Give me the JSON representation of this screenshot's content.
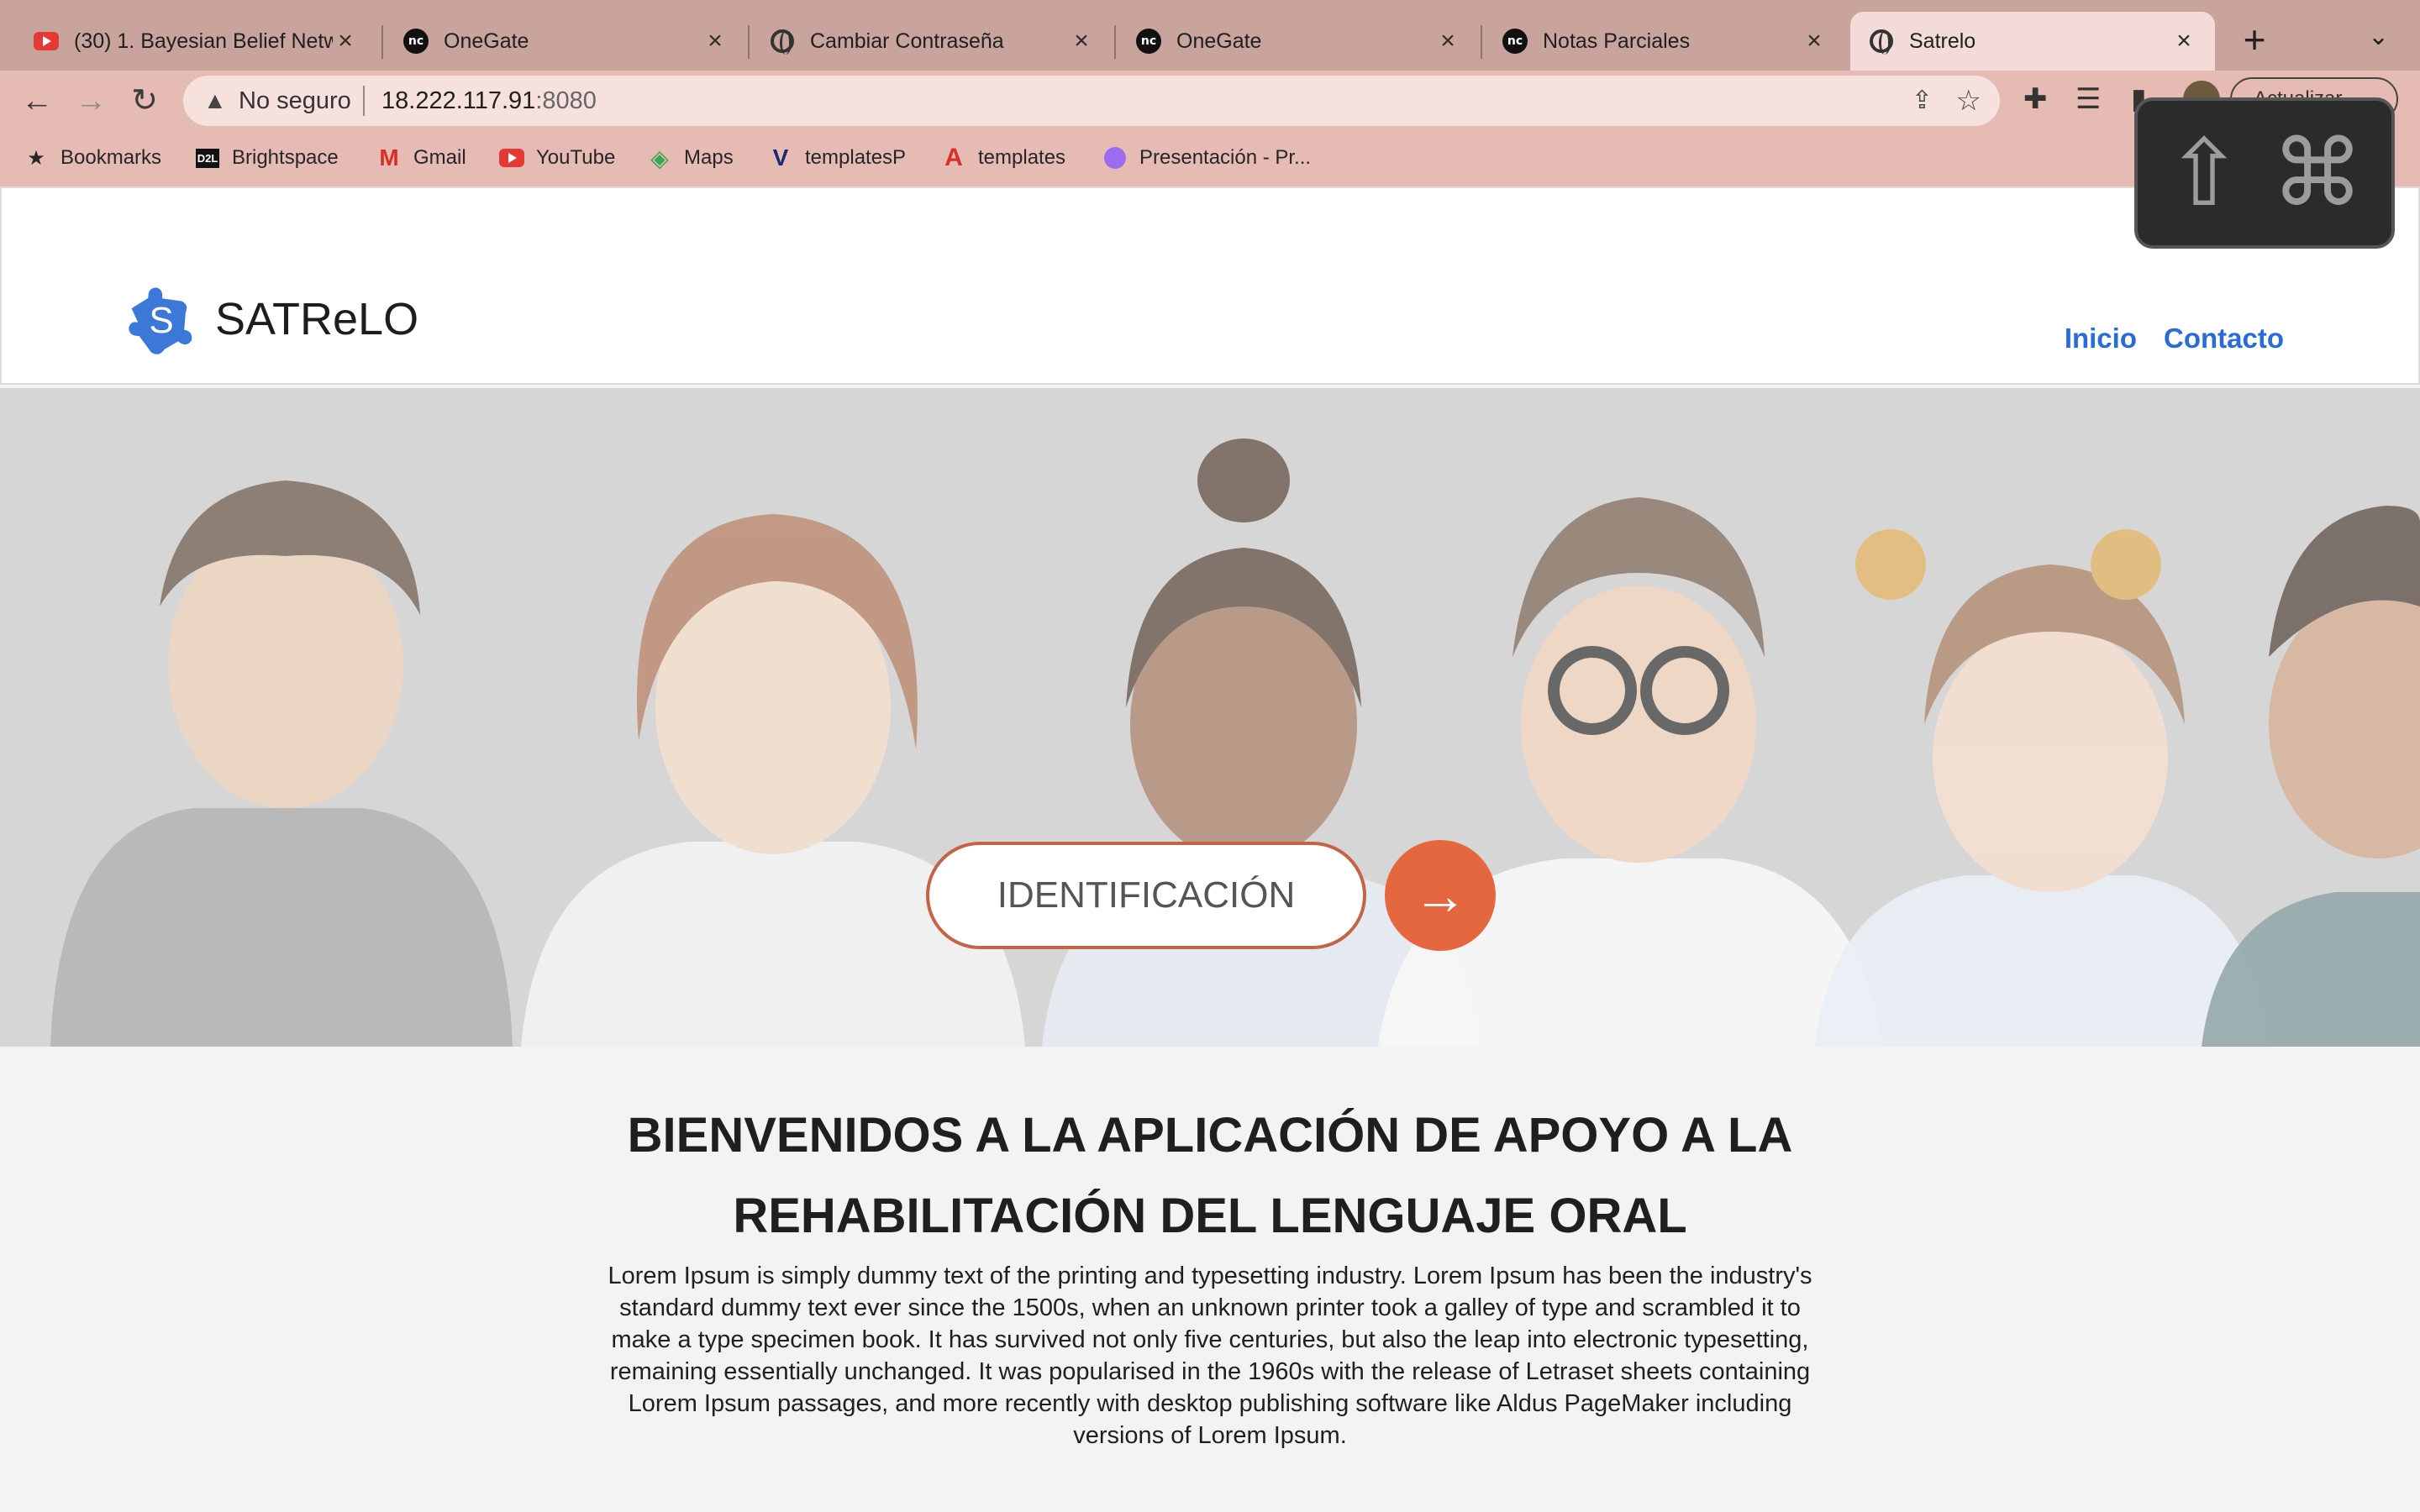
{
  "browser": {
    "tabs": [
      {
        "title": "(30) 1. Bayesian Belief Netw",
        "icon": "youtube-icon"
      },
      {
        "title": "OneGate",
        "icon": "onegate-icon"
      },
      {
        "title": "Cambiar Contraseña",
        "icon": "globe-icon"
      },
      {
        "title": "OneGate",
        "icon": "onegate-icon"
      },
      {
        "title": "Notas Parciales",
        "icon": "onegate-icon"
      },
      {
        "title": "Satrelo",
        "icon": "globe-icon",
        "active": true
      }
    ],
    "address": {
      "security_label": "No seguro",
      "host": "18.222.117.91",
      "port": ":8080"
    },
    "update_button": "Actualizar",
    "bookmarks": [
      {
        "label": "Bookmarks",
        "icon": "star-icon"
      },
      {
        "label": "Brightspace",
        "icon": "d2l-icon"
      },
      {
        "label": "Gmail",
        "icon": "gmail-icon"
      },
      {
        "label": "YouTube",
        "icon": "youtube-icon"
      },
      {
        "label": "Maps",
        "icon": "maps-icon"
      },
      {
        "label": "templatesP",
        "icon": "templatesp-icon"
      },
      {
        "label": "templates",
        "icon": "templates-icon"
      },
      {
        "label": "Presentación - Pr...",
        "icon": "presentation-icon"
      }
    ],
    "shortcut_overlay": {
      "keys": [
        "⇧",
        "⌘"
      ]
    }
  },
  "site": {
    "brand": "SATReLO",
    "nav": {
      "home": "Inicio",
      "contact": "Contacto"
    },
    "hero": {
      "id_button": "IDENTIFICACIÓN",
      "go_button_icon": "arrow-right-icon"
    },
    "welcome_title": "BIENVENIDOS A LA APLICACIÓN DE APOYO A LA REHABILITACIÓN DEL LENGUAJE ORAL",
    "lorem": "Lorem Ipsum is simply dummy text of the printing and typesetting industry. Lorem Ipsum has been the industry's standard dummy text ever since the 1500s, when an unknown printer took a galley of type and scrambled it to make a type specimen book. It has survived not only five centuries, but also the leap into electronic typesetting, remaining essentially unchanged. It was popularised in the 1960s with the release of Letraset sheets containing Lorem Ipsum passages, and more recently with desktop publishing software like Aldus PageMaker including versions of Lorem Ipsum."
  },
  "colors": {
    "accent_orange": "#e4673f",
    "nav_blue": "#2a6cd6",
    "logo_blue": "#3b78d8",
    "chrome_tabstrip": "#c9a49d",
    "chrome_toolbar": "#e6bbb4"
  }
}
